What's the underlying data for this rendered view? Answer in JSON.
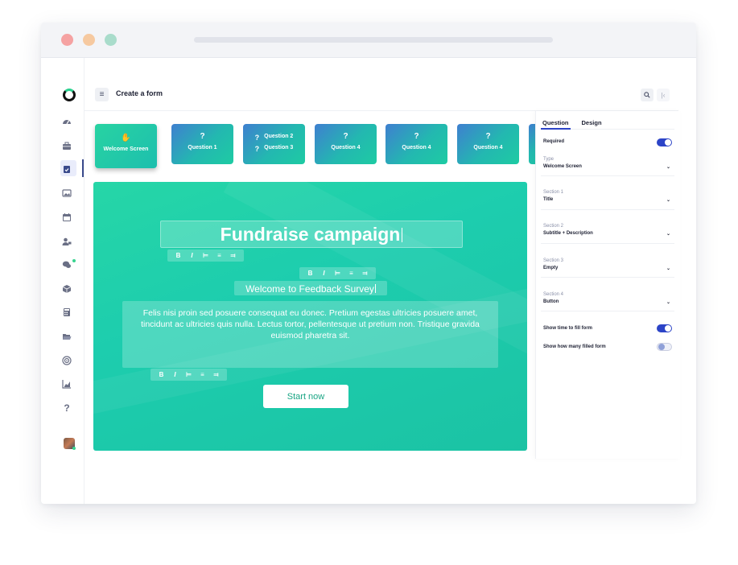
{
  "header": {
    "title": "Create a form"
  },
  "cards": [
    {
      "icon": "hand-wave-icon",
      "glyph": "✋",
      "label": "Welcome Screen"
    },
    {
      "icon": "question-icon",
      "glyph": "?",
      "label": "Question 1"
    },
    {
      "icon": "question-icon",
      "glyph": "?",
      "label_a": "Question 2",
      "label_b": "Question 3"
    },
    {
      "icon": "question-icon",
      "glyph": "?",
      "label": "Question 4"
    },
    {
      "icon": "question-icon",
      "glyph": "?",
      "label": "Question 4"
    },
    {
      "icon": "question-icon",
      "glyph": "?",
      "label": "Question 4"
    }
  ],
  "canvas": {
    "title": "Fundraise campaign",
    "subtitle": "Welcome to  Feedback Survey",
    "description": "Felis nisi proin sed posuere consequat eu donec. Pretium egestas ultricies posuere amet, tincidunt ac ultricies quis nulla. Lectus tortor, pellentesque ut pretium non. Tristique gravida euismod pharetra sit.",
    "start_button": "Start now",
    "format": {
      "bold": "B",
      "italic": "I",
      "align_left": "⊨",
      "align_center": "≡",
      "align_right": "⫤"
    }
  },
  "panel": {
    "tabs": [
      "Question",
      "Design"
    ],
    "required_label": "Required",
    "required_on": true,
    "type_label": "Type",
    "type_value": "Welcome Screen",
    "sections": [
      {
        "label": "Section 1",
        "value": "Title"
      },
      {
        "label": "Section 2",
        "value": "Subtitle + Description"
      },
      {
        "label": "Section 3",
        "value": "Empty"
      },
      {
        "label": "Section 4",
        "value": "Button"
      }
    ],
    "show_time_label": "Show time to fill form",
    "show_time_on": true,
    "show_count_label": "Show how many filled form",
    "show_count_on": false
  },
  "colors": {
    "accent": "#2c44c7",
    "canvas": "#1ecfa8",
    "card_gradient_start": "#3f7fd0"
  }
}
